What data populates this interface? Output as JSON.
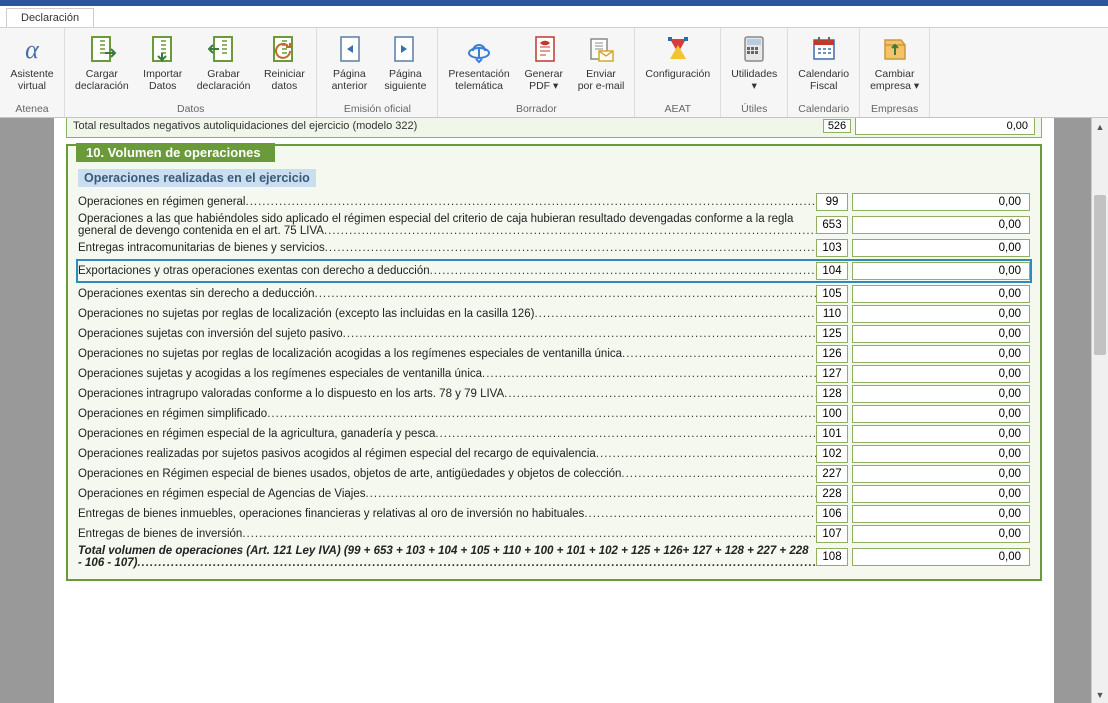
{
  "tab": "Declaración",
  "ribbon": {
    "groups": [
      {
        "name": "Atenea",
        "items": [
          {
            "key": "asistente",
            "label": "Asistente\nvirtual"
          }
        ]
      },
      {
        "name": "Datos",
        "items": [
          {
            "key": "cargar",
            "label": "Cargar\ndeclaración"
          },
          {
            "key": "importar",
            "label": "Importar\nDatos"
          },
          {
            "key": "grabar",
            "label": "Grabar\ndeclaración"
          },
          {
            "key": "reiniciar",
            "label": "Reiniciar\ndatos"
          }
        ]
      },
      {
        "name": "Emisión oficial",
        "items": [
          {
            "key": "anterior",
            "label": "Página\nanterior"
          },
          {
            "key": "siguiente",
            "label": "Página\nsiguiente"
          }
        ]
      },
      {
        "name": "Borrador",
        "items": [
          {
            "key": "telematica",
            "label": "Presentación\ntelemática"
          },
          {
            "key": "pdf",
            "label": "Generar\nPDF ▾"
          },
          {
            "key": "email",
            "label": "Enviar\npor e-mail"
          }
        ]
      },
      {
        "name": "AEAT",
        "items": [
          {
            "key": "config",
            "label": "Configuración\n "
          }
        ]
      },
      {
        "name": "Útiles",
        "items": [
          {
            "key": "utilidades",
            "label": "Utilidades\n▾"
          }
        ]
      },
      {
        "name": "Calendario",
        "items": [
          {
            "key": "calendario",
            "label": "Calendario\nFiscal"
          }
        ]
      },
      {
        "name": "Empresas",
        "items": [
          {
            "key": "cambiar",
            "label": "Cambiar\nempresa ▾"
          }
        ]
      }
    ]
  },
  "prev_row": {
    "text": "Total resultados negativos autoliquidaciones del ejercicio (modelo 322)",
    "cell": "526",
    "value": "0,00"
  },
  "section": {
    "title": "10. Volumen de operaciones",
    "subhead": "Operaciones realizadas en el ejercicio",
    "rows": [
      {
        "desc": "Operaciones en régimen general ",
        "cell": "99",
        "value": "0,00"
      },
      {
        "desc": "Operaciones a las que habiéndoles sido aplicado el régimen especial del criterio de caja hubieran resultado devengadas conforme a la regla general de devengo contenida en el art. 75 LIVA ",
        "cell": "653",
        "value": "0,00"
      },
      {
        "desc": "Entregas intracomunitarias de bienes y servicios ",
        "cell": "103",
        "value": "0,00"
      },
      {
        "desc": "Exportaciones y otras operaciones exentas con derecho a deducción ",
        "cell": "104",
        "value": "0,00",
        "highlight": true
      },
      {
        "desc": "Operaciones exentas sin derecho a deducción ",
        "cell": "105",
        "value": "0,00"
      },
      {
        "desc": "Operaciones no sujetas por reglas de localización (excepto las incluidas en la casilla 126)  ",
        "cell": "110",
        "value": "0,00"
      },
      {
        "desc": "Operaciones sujetas con inversión del sujeto pasivo ",
        "cell": "125",
        "value": "0,00"
      },
      {
        "desc": "Operaciones no sujetas por reglas de localización acogidas a los regímenes especiales de ventanilla única ",
        "cell": "126",
        "value": "0,00"
      },
      {
        "desc": "Operaciones sujetas y acogidas a los regímenes especiales de ventanilla única ",
        "cell": "127",
        "value": "0,00"
      },
      {
        "desc": "Operaciones intragrupo valoradas conforme a lo dispuesto en los arts. 78 y 79 LIVA ",
        "cell": "128",
        "value": "0,00"
      },
      {
        "desc": "Operaciones en régimen simplificado",
        "cell": "100",
        "value": "0,00"
      },
      {
        "desc": "Operaciones en régimen especial de la agricultura, ganadería y pesca",
        "cell": "101",
        "value": "0,00"
      },
      {
        "desc": "Operaciones realizadas por sujetos pasivos acogidos al régimen especial del recargo de equivalencia ",
        "cell": "102",
        "value": "0,00"
      },
      {
        "desc": "Operaciones en Régimen especial de bienes usados, objetos  de arte, antigüedades  y objetos de colección ",
        "cell": "227",
        "value": "0,00"
      },
      {
        "desc": "Operaciones en régimen especial de Agencias de Viajes ",
        "cell": "228",
        "value": "0,00"
      },
      {
        "desc": "Entregas de bienes inmuebles, operaciones financieras y relativas al oro de inversión no habituales",
        "cell": "106",
        "value": "0,00"
      },
      {
        "desc": "Entregas de bienes de inversión ",
        "cell": "107",
        "value": "0,00"
      },
      {
        "desc": "Total volumen de operaciones (Art. 121 Ley IVA) (99 + 653 + 103 + 104 + 105 + 110 + 100 + 101 + 102 + 125 + 126+ 127 + 128 + 227 + 228 - 106 - 107) ",
        "cell": "108",
        "value": "0,00",
        "total": true
      }
    ]
  }
}
